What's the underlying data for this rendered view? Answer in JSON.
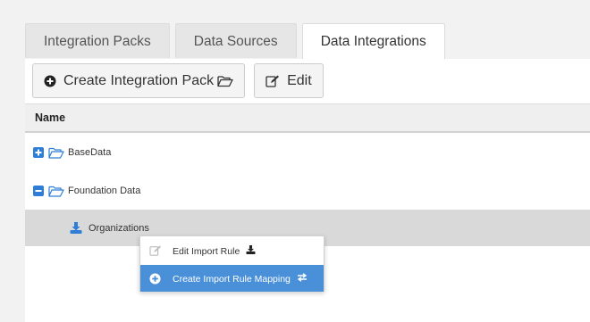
{
  "tabs": [
    {
      "label": "Integration Packs",
      "active": false
    },
    {
      "label": "Data Sources",
      "active": false
    },
    {
      "label": "Data Integrations",
      "active": true
    }
  ],
  "toolbar": {
    "create_label": "Create Integration Pack",
    "edit_label": "Edit"
  },
  "table": {
    "header": "Name"
  },
  "tree": {
    "items": [
      {
        "label": "BaseData",
        "expander": "plus-square-icon",
        "icon": "folder-open-icon"
      },
      {
        "label": "Foundation Data",
        "expander": "minus-square-icon",
        "icon": "folder-open-icon"
      },
      {
        "label": "Organizations",
        "icon": "download-icon",
        "selected": true
      }
    ]
  },
  "context_menu": {
    "edit_label": "Edit Import Rule",
    "create_label": "Create Import Rule Mapping"
  },
  "colors": {
    "accent": "#4a90d9",
    "tree_blue": "#2e7dd7",
    "selected_row": "#d9d9d9"
  }
}
